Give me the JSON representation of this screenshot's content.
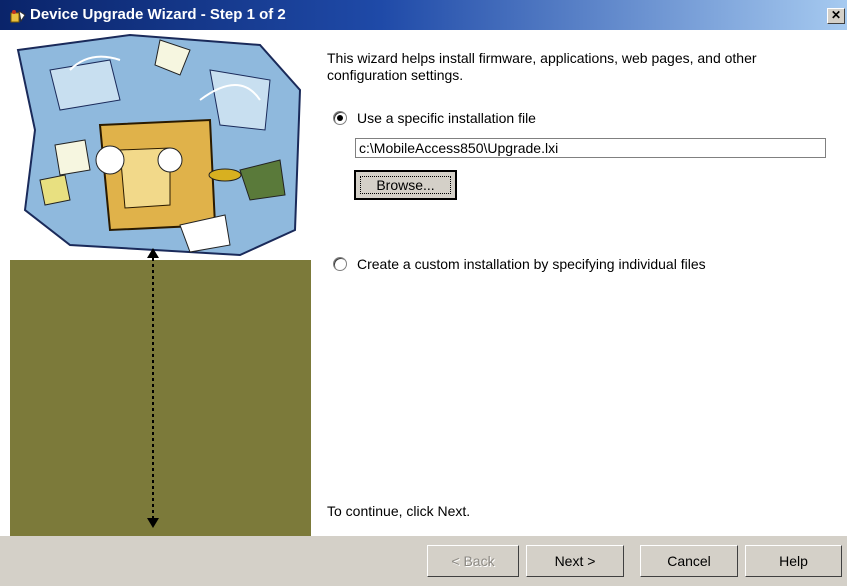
{
  "window": {
    "title": "Device Upgrade Wizard - Step 1 of 2",
    "close_glyph": "✕"
  },
  "content": {
    "intro": "This wizard helps install firmware, applications, web pages, and other configuration settings.",
    "option_specific": "Use a specific installation file",
    "file_path": "c:\\MobileAccess850\\Upgrade.lxi",
    "browse_label": "Browse...",
    "option_custom": "Create a custom installation by specifying individual files",
    "continue_hint": "To continue, click Next.",
    "selected_option": "specific"
  },
  "buttons": {
    "back": "< Back",
    "next": "Next >",
    "cancel": "Cancel",
    "help": "Help"
  },
  "colors": {
    "title_start": "#0a246a",
    "title_end": "#a6caf0",
    "side_panel": "#7c7a3a",
    "dialog_face": "#d4d0c8"
  }
}
